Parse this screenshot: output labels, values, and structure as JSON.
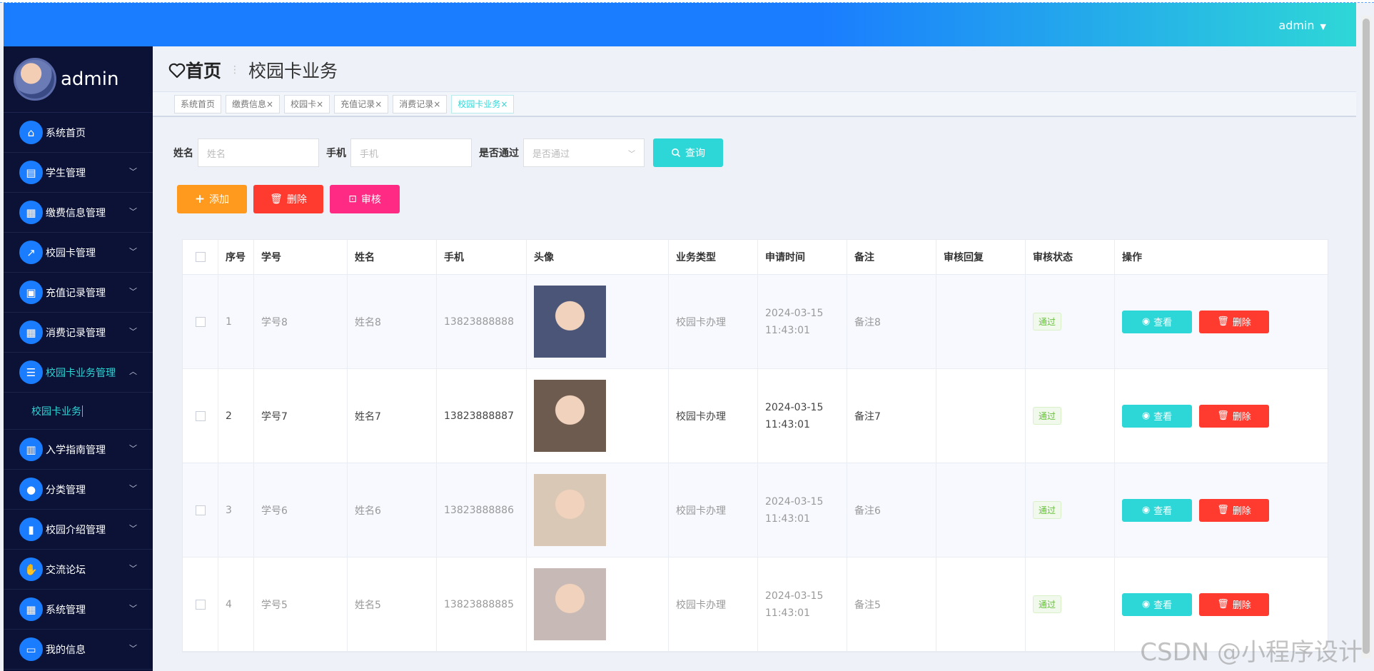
{
  "header": {
    "user": "admin",
    "caret": "▼"
  },
  "sidebar": {
    "profile_name": "admin",
    "items": [
      {
        "label": "系统首页",
        "icon": "home-icon",
        "glyph": "⌂",
        "chevron": ""
      },
      {
        "label": "学生管理",
        "icon": "chat-icon",
        "glyph": "▤",
        "chevron": "﹀"
      },
      {
        "label": "缴费信息管理",
        "icon": "grid-icon",
        "glyph": "▦",
        "chevron": "﹀"
      },
      {
        "label": "校园卡管理",
        "icon": "chart-line-icon",
        "glyph": "↗",
        "chevron": "﹀"
      },
      {
        "label": "充值记录管理",
        "icon": "briefcase-icon",
        "glyph": "▣",
        "chevron": "﹀"
      },
      {
        "label": "消费记录管理",
        "icon": "grid-icon",
        "glyph": "▦",
        "chevron": "﹀"
      },
      {
        "label": "校园卡业务管理",
        "icon": "list-icon",
        "glyph": "☰",
        "chevron": "︿"
      },
      {
        "label": "入学指南管理",
        "icon": "bar-chart-icon",
        "glyph": "▥",
        "chevron": "﹀"
      },
      {
        "label": "分类管理",
        "icon": "user-icon",
        "glyph": "●",
        "chevron": "﹀"
      },
      {
        "label": "校园介绍管理",
        "icon": "building-icon",
        "glyph": "▮",
        "chevron": "﹀"
      },
      {
        "label": "交流论坛",
        "icon": "thumb-icon",
        "glyph": "✋",
        "chevron": "﹀"
      },
      {
        "label": "系统管理",
        "icon": "grid-icon",
        "glyph": "▦",
        "chevron": "﹀"
      },
      {
        "label": "我的信息",
        "icon": "wallet-icon",
        "glyph": "▭",
        "chevron": "﹀"
      }
    ],
    "submenu_label": "校园卡业务"
  },
  "breadcrumb": {
    "home": "首页",
    "current": "校园卡业务",
    "sep": "⋮"
  },
  "tags": [
    {
      "label": "系统首页",
      "close": ""
    },
    {
      "label": "缴费信息",
      "close": "×"
    },
    {
      "label": "校园卡",
      "close": "×"
    },
    {
      "label": "充值记录",
      "close": "×"
    },
    {
      "label": "消费记录",
      "close": "×"
    },
    {
      "label": "校园卡业务",
      "close": "×"
    }
  ],
  "search": {
    "name_label": "姓名",
    "name_placeholder": "姓名",
    "phone_label": "手机",
    "phone_placeholder": "手机",
    "pass_label": "是否通过",
    "pass_placeholder": "是否通过",
    "query_label": "查询"
  },
  "actions": {
    "add": "添加",
    "delete": "删除",
    "audit": "审核"
  },
  "table": {
    "headers": [
      "序号",
      "学号",
      "姓名",
      "手机",
      "头像",
      "业务类型",
      "申请时间",
      "备注",
      "审核回复",
      "审核状态",
      "操作"
    ],
    "rows": [
      {
        "index": "1",
        "student_no": "学号8",
        "name": "姓名8",
        "phone": "13823888888",
        "type": "校园卡办理",
        "time": "2024-03-15 11:43:01",
        "remark": "备注8",
        "reply": "",
        "status": "通过",
        "view": "查看",
        "del": "删除",
        "photo_color": "#4a5578"
      },
      {
        "index": "2",
        "student_no": "学号7",
        "name": "姓名7",
        "phone": "13823888887",
        "type": "校园卡办理",
        "time": "2024-03-15 11:43:01",
        "remark": "备注7",
        "reply": "",
        "status": "通过",
        "view": "查看",
        "del": "删除",
        "photo_color": "#6d5b4f"
      },
      {
        "index": "3",
        "student_no": "学号6",
        "name": "姓名6",
        "phone": "13823888886",
        "type": "校园卡办理",
        "time": "2024-03-15 11:43:01",
        "remark": "备注6",
        "reply": "",
        "status": "通过",
        "view": "查看",
        "del": "删除",
        "photo_color": "#d9c8b6"
      },
      {
        "index": "4",
        "student_no": "学号5",
        "name": "姓名5",
        "phone": "13823888885",
        "type": "校园卡办理",
        "time": "2024-03-15 11:43:01",
        "remark": "备注5",
        "reply": "",
        "status": "通过",
        "view": "查看",
        "del": "删除",
        "photo_color": "#c7b9b5"
      }
    ]
  },
  "watermark": "CSDN @小程序设计",
  "colors": {
    "primary": "#1a7cff",
    "accent": "#2ed7d7",
    "danger": "#ff3b30",
    "warning": "#ff9a1f",
    "pink": "#ff2a84",
    "sidebar": "#0b1235"
  }
}
